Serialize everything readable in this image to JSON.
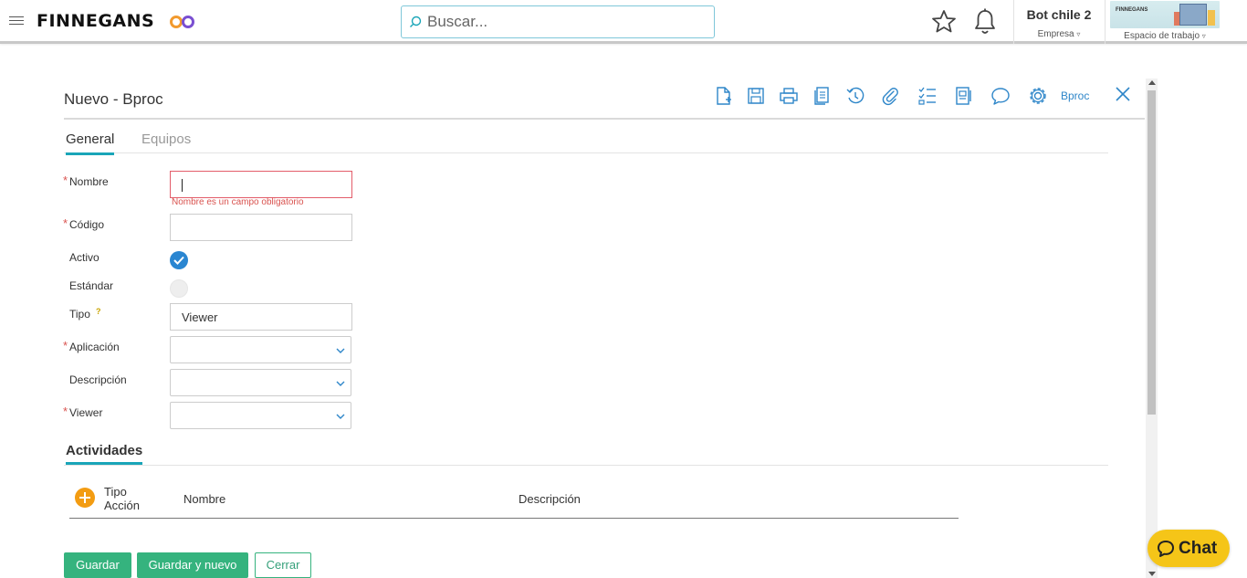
{
  "header": {
    "logo_text": "FINNEGANS",
    "search_placeholder": "Buscar...",
    "user_name": "Bot chile 2",
    "company_label": "Empresa",
    "workspace_label": "Espacio de trabajo",
    "workspace_image_text": "FINNEGANS"
  },
  "form": {
    "title": "Nuevo - Bproc",
    "toolbar_link": "Bproc",
    "tabs": [
      {
        "label": "General",
        "active": true
      },
      {
        "label": "Equipos",
        "active": false
      }
    ],
    "fields": {
      "nombre": {
        "label": "Nombre",
        "required": true,
        "value": "",
        "error": "Nombre es un campo obligatorio"
      },
      "codigo": {
        "label": "Código",
        "required": true,
        "value": ""
      },
      "activo": {
        "label": "Activo",
        "checked": true
      },
      "estandar": {
        "label": "Estándar",
        "checked": false
      },
      "tipo": {
        "label": "Tipo",
        "value": "Viewer",
        "help": "?"
      },
      "aplicacion": {
        "label": "Aplicación",
        "required": true,
        "value": ""
      },
      "descripcion": {
        "label": "Descripción",
        "value": ""
      },
      "viewer": {
        "label": "Viewer",
        "required": true,
        "value": ""
      }
    },
    "required_mark": "*",
    "actividades": {
      "title": "Actividades",
      "columns": [
        "Tipo Acción",
        "Nombre",
        "Descripción"
      ]
    },
    "buttons": {
      "save": "Guardar",
      "save_new": "Guardar y nuevo",
      "close": "Cerrar"
    }
  },
  "chat": {
    "label": "Chat"
  },
  "colors": {
    "accent": "#1aa5b8",
    "primary_button": "#35b37e",
    "error": "#d9534f",
    "link": "#2e86c9",
    "chat_button": "#f5c518"
  }
}
